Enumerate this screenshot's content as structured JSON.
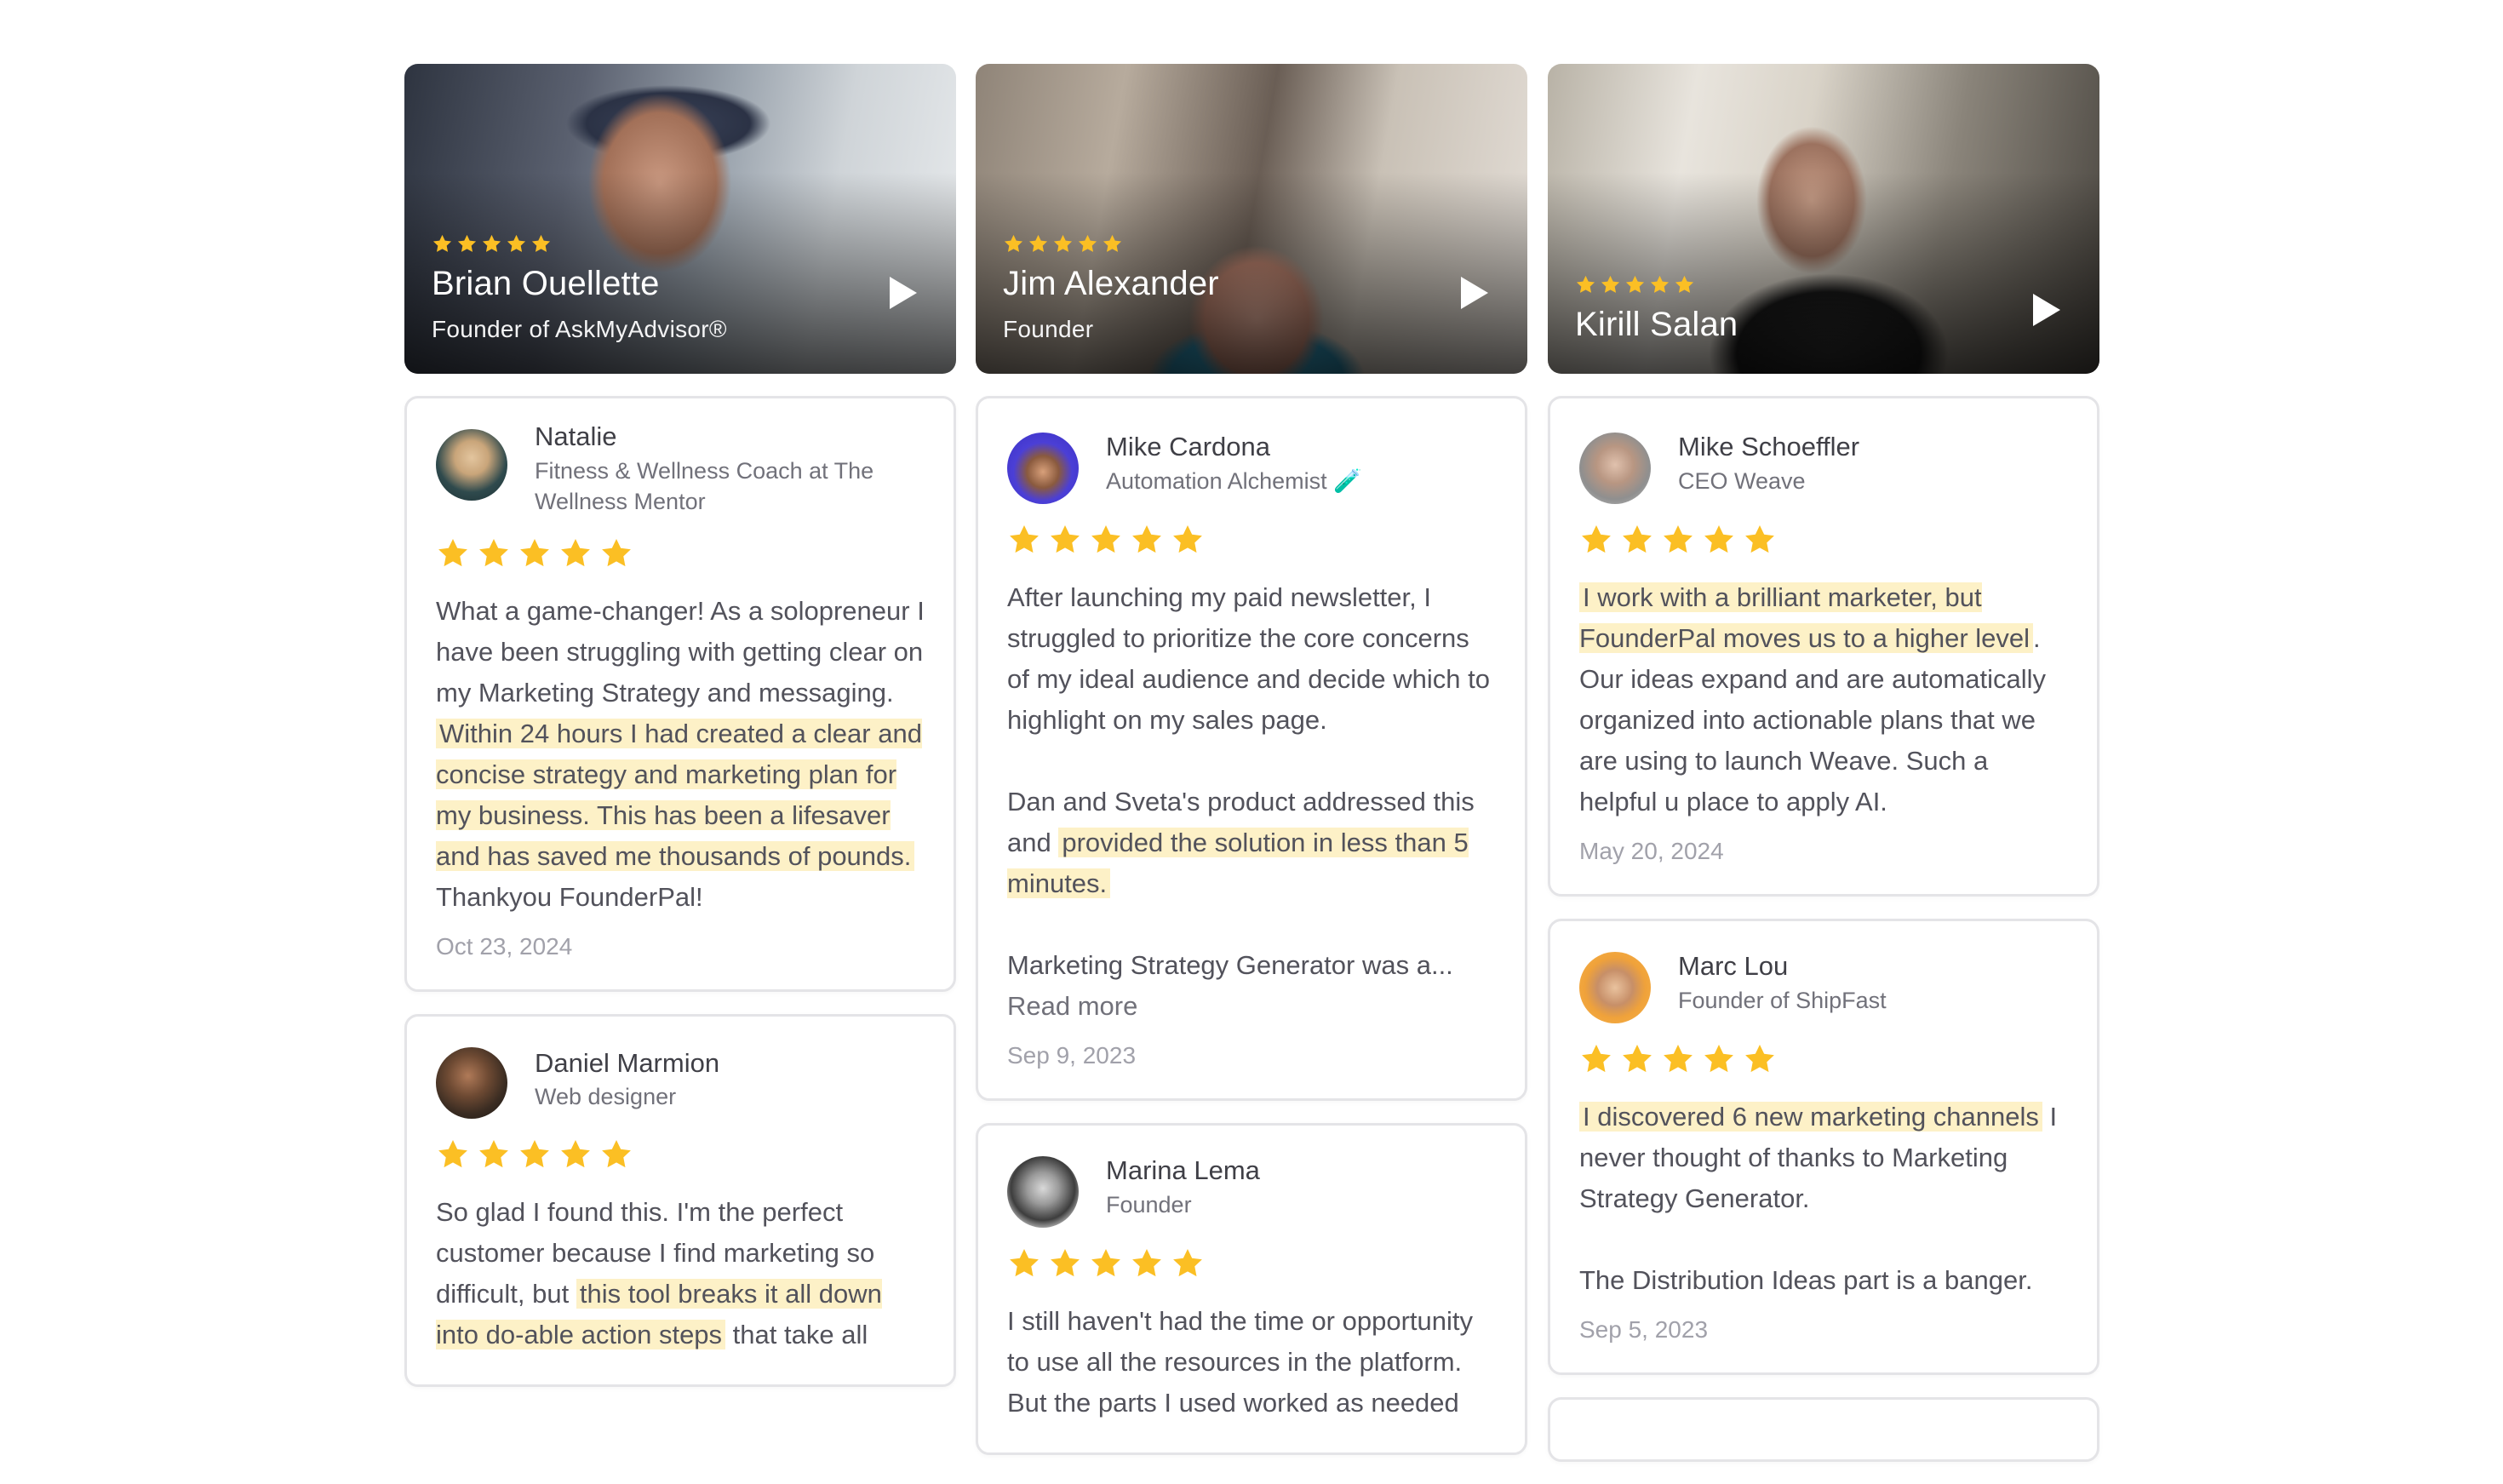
{
  "colors": {
    "star": "#fbbf24",
    "highlight": "#fdf1c7",
    "border": "#e4e4e7"
  },
  "videos": [
    {
      "name": "Brian Ouellette",
      "role": "Founder of AskMyAdvisor®",
      "rating": 5,
      "play_icon": "play-icon"
    },
    {
      "name": "Jim Alexander",
      "role": "Founder",
      "rating": 5,
      "play_icon": "play-icon"
    },
    {
      "name": "Kirill Salan",
      "role": "",
      "rating": 5,
      "play_icon": "play-icon"
    }
  ],
  "reviews": {
    "natalie": {
      "name": "Natalie",
      "role": "Fitness & Wellness Coach at The Wellness Mentor",
      "rating": 5,
      "text_before": "What a game-changer! As a solopreneur I have been struggling with getting clear on my Marketing Strategy and messaging. ",
      "highlight": "Within 24 hours I had created a clear and concise strategy and marketing plan for my business. This has been a lifesaver and has saved me thousands of pounds.",
      "text_after": " Thankyou FounderPal!",
      "date": "Oct 23, 2024"
    },
    "daniel": {
      "name": "Daniel Marmion",
      "role": "Web designer",
      "rating": 5,
      "text_before": "So glad I found this. I'm the perfect customer because I find marketing so difficult, but ",
      "highlight": "this tool breaks it all down into do-able action steps",
      "text_after": " that take all"
    },
    "mike_cardona": {
      "name": "Mike Cardona",
      "role": "Automation Alchemist 🧪",
      "rating": 5,
      "para1": "After launching my paid newsletter, I struggled to prioritize the core concerns of my ideal audience and decide which to highlight on my sales page.",
      "para2_before": "Dan and Sveta's product addressed this and ",
      "para2_highlight": "provided the solution in less than 5 minutes.",
      "para3": "Marketing Strategy Generator was a...",
      "read_more": "Read more",
      "date": "Sep 9, 2023"
    },
    "marina": {
      "name": "Marina Lema",
      "role": "Founder",
      "rating": 5,
      "text": "I still haven't had the time or opportunity to use all the resources in the platform. But the parts I used worked as needed"
    },
    "mike_schoeffler": {
      "name": "Mike Schoeffler",
      "role": "CEO Weave",
      "rating": 5,
      "highlight": "I work with a brilliant marketer, but FounderPal moves us to a higher level",
      "text_after": ". Our ideas expand and are automatically organized into actionable plans that we are using to launch Weave. Such a helpful u place to apply AI.",
      "date": "May 20, 2024"
    },
    "marc": {
      "name": "Marc Lou",
      "role": "Founder of ShipFast",
      "rating": 5,
      "highlight": "I discovered 6 new marketing channels",
      "text_after": " I never thought of thanks to Marketing Strategy Generator.",
      "para2": "The Distribution Ideas part is a banger.",
      "date": "Sep 5, 2023"
    }
  }
}
